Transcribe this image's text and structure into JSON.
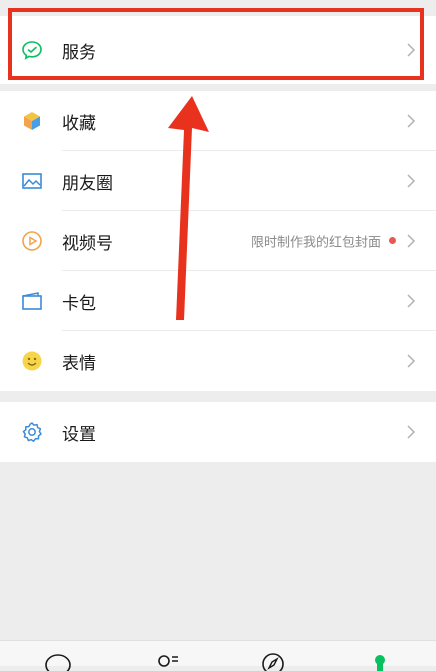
{
  "menu": {
    "services": {
      "label": "服务",
      "icon": "wechat-pay-icon"
    },
    "items": [
      {
        "label": "收藏",
        "icon": "favorites-cube-icon"
      },
      {
        "label": "朋友圈",
        "icon": "moments-picture-icon"
      },
      {
        "label": "视频号",
        "icon": "channels-play-icon",
        "extra": "限时制作我的红包封面",
        "badge": "red-dot"
      },
      {
        "label": "卡包",
        "icon": "card-wallet-icon"
      },
      {
        "label": "表情",
        "icon": "sticker-smiley-icon"
      }
    ],
    "settings": {
      "label": "设置",
      "icon": "settings-gear-icon"
    }
  },
  "tabbar": {
    "tabs": [
      {
        "icon": "chats-bubble-icon"
      },
      {
        "icon": "contacts-icon"
      },
      {
        "icon": "discover-compass-icon"
      },
      {
        "icon": "me-person-icon",
        "active": true
      }
    ]
  },
  "colors": {
    "highlight": "#e8321e",
    "background": "#ededed",
    "accent_green": "#07c160",
    "badge": "#e55a52"
  }
}
